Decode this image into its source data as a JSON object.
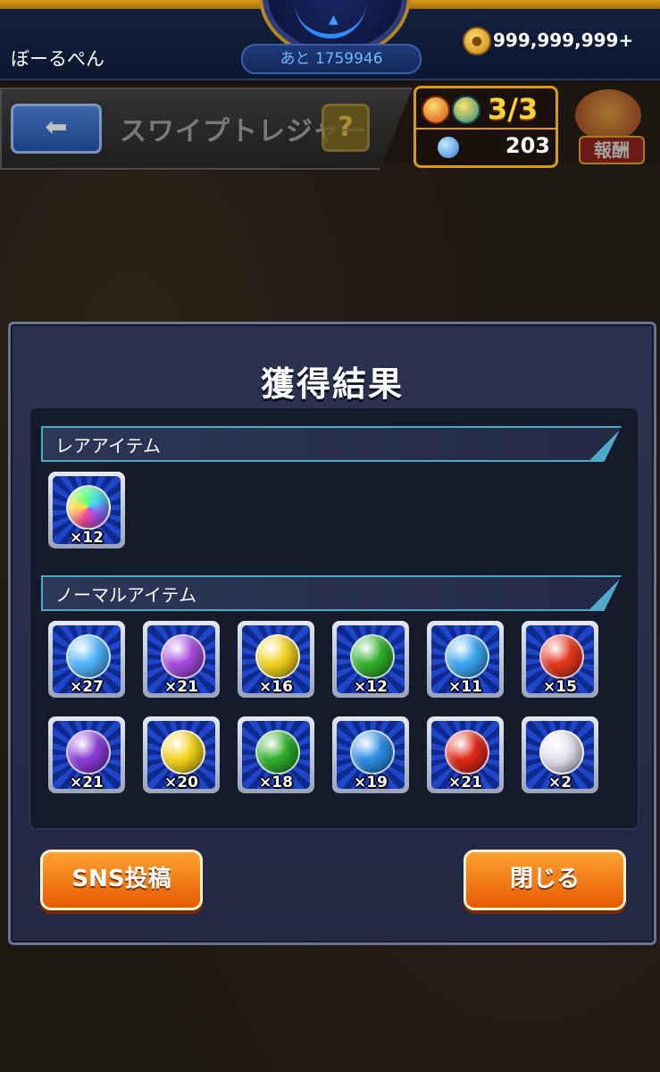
{
  "top_bar": {
    "username": "ぼーるぺん",
    "remaining": "あと 1759946",
    "coins": "999,999,999+"
  },
  "header": {
    "title": "スワイプトレジャー",
    "help_label": "?",
    "back_label": "⬅",
    "attempts": "3/3",
    "gems": "203",
    "reward_label": "報酬"
  },
  "modal": {
    "title": "獲得結果",
    "rare_section_label": "レアアイテム",
    "normal_section_label": "ノーマルアイテム",
    "rare_items": [
      {
        "icon": "rainbow-orb-icon",
        "qty": "×12",
        "color": "rainbow"
      }
    ],
    "normal_items_row1": [
      {
        "icon": "water-crystal-icon",
        "qty": "×27",
        "color": "#4fb6ff"
      },
      {
        "icon": "dark-crystal-icon",
        "qty": "×21",
        "color": "#a64be0"
      },
      {
        "icon": "light-crystal-icon",
        "qty": "×16",
        "color": "#f2d21e"
      },
      {
        "icon": "wood-crystal-icon",
        "qty": "×12",
        "color": "#33b02c"
      },
      {
        "icon": "water-crystal-icon",
        "qty": "×11",
        "color": "#39a6f2"
      },
      {
        "icon": "fire-crystal-icon",
        "qty": "×15",
        "color": "#e8371e"
      }
    ],
    "normal_items_row2": [
      {
        "icon": "dark-orb-icon",
        "qty": "×21",
        "color": "#8b3bd8"
      },
      {
        "icon": "light-orb-icon",
        "qty": "×20",
        "color": "#f4d41a"
      },
      {
        "icon": "wood-orb-icon",
        "qty": "×18",
        "color": "#2fb02a"
      },
      {
        "icon": "water-orb-icon",
        "qty": "×19",
        "color": "#2e8ee6"
      },
      {
        "icon": "fire-orb-icon",
        "qty": "×21",
        "color": "#e02a1a"
      },
      {
        "icon": "rainbow-feather-orb-icon",
        "qty": "×2",
        "color": "#e7e2f0"
      }
    ],
    "sns_button": "SNS投稿",
    "close_button": "閉じる"
  }
}
